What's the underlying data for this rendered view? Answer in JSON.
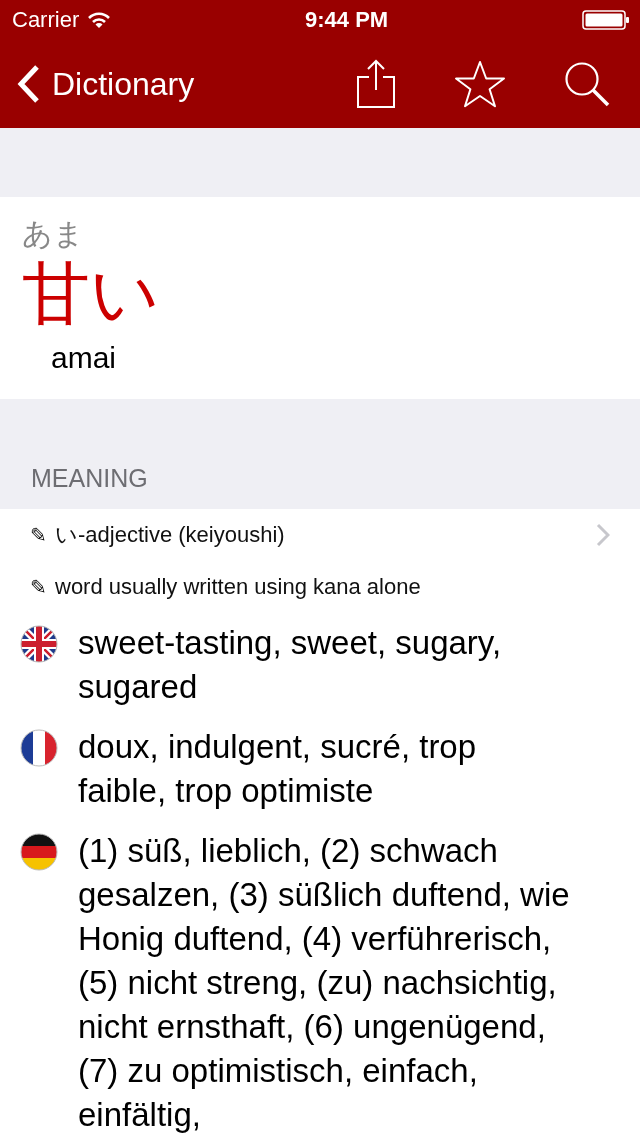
{
  "status_bar": {
    "carrier": "Carrier",
    "time": "9:44 PM"
  },
  "nav": {
    "back_label": "Dictionary"
  },
  "entry": {
    "reading": "あま",
    "headword": "甘い",
    "romaji": "amai"
  },
  "section_header": "MEANING",
  "notes": [
    {
      "icon": "✎",
      "text": "い-adjective (keiyoushi)",
      "has_disclosure": true
    },
    {
      "icon": "✎",
      "text": "word usually written using kana alone",
      "has_disclosure": false
    }
  ],
  "translations": [
    {
      "kind": "uk",
      "text": "sweet-tasting, sweet, sugary, sugared"
    },
    {
      "kind": "fr",
      "text": "doux, indulgent, sucré, trop faible, trop optimiste"
    },
    {
      "kind": "de",
      "text": "(1) süß, lieblich, (2) schwach gesalzen, (3) süßlich duftend, wie Honig duftend, (4) verführerisch, (5) nicht streng, (zu) nachsichtig, nicht ernsthaft, (6) ungenügend, (7) zu optimistisch, einfach, einfältig,"
    }
  ]
}
